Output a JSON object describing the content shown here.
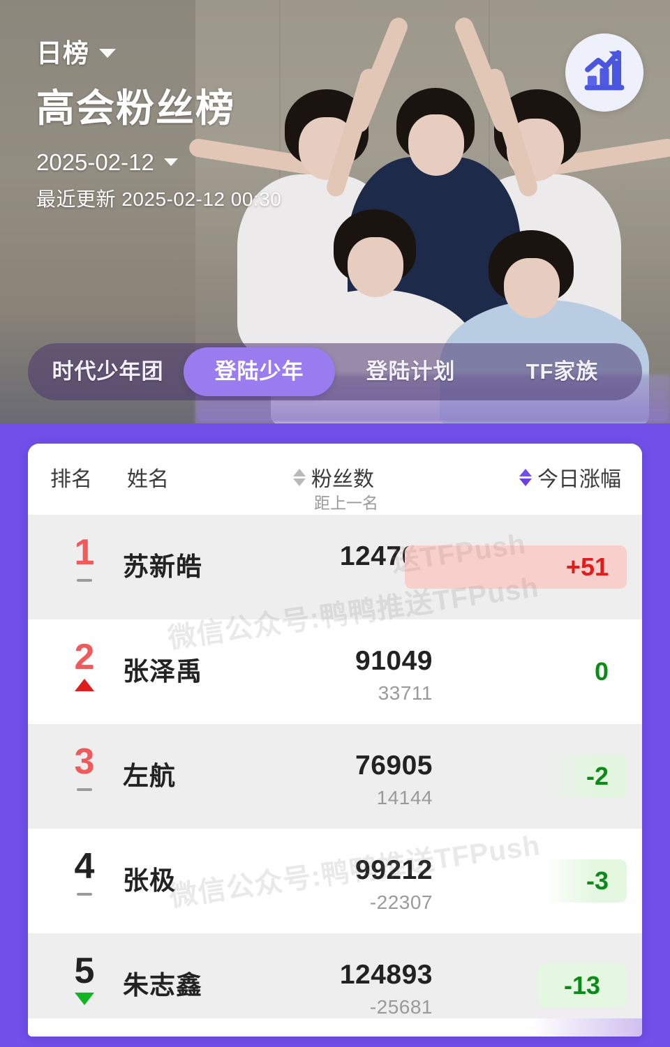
{
  "header": {
    "kind_label": "日榜",
    "title": "高会粉丝榜",
    "date": "2025-02-12",
    "updated": "最近更新 2025-02-12 00:30",
    "trend_icon": "bar-chart-up-icon",
    "accent_purple": "#7150ea",
    "active_tab_purple": "#9a7cef"
  },
  "tabs": [
    {
      "label": "时代少年团",
      "active": false
    },
    {
      "label": "登陆少年",
      "active": true
    },
    {
      "label": "登陆计划",
      "active": false
    },
    {
      "label": "TF家族",
      "active": false
    }
  ],
  "table": {
    "columns": {
      "rank": "排名",
      "name": "姓名",
      "fans": "粉丝数",
      "fans_sub": "距上一名",
      "change": "今日涨幅"
    },
    "rows": [
      {
        "rank": "1",
        "marker": "dash",
        "name": "苏新皓",
        "fans": "124760",
        "gap": "",
        "change": "+51",
        "change_kind": "up"
      },
      {
        "rank": "2",
        "marker": "up",
        "name": "张泽禹",
        "fans": "91049",
        "gap": "33711",
        "change": "0",
        "change_kind": "flat"
      },
      {
        "rank": "3",
        "marker": "dash",
        "name": "左航",
        "fans": "76905",
        "gap": "14144",
        "change": "-2",
        "change_kind": "dn-s"
      },
      {
        "rank": "4",
        "marker": "dash",
        "name": "张极",
        "fans": "99212",
        "gap": "-22307",
        "change": "-3",
        "change_kind": "dn-s"
      },
      {
        "rank": "5",
        "marker": "down",
        "name": "朱志鑫",
        "fans": "124893",
        "gap": "-25681",
        "change": "-13",
        "change_kind": "dn-b"
      }
    ]
  },
  "watermark": {
    "text": "微信公众号:鸭鸭推送TFPush",
    "short": "送TFPush"
  }
}
